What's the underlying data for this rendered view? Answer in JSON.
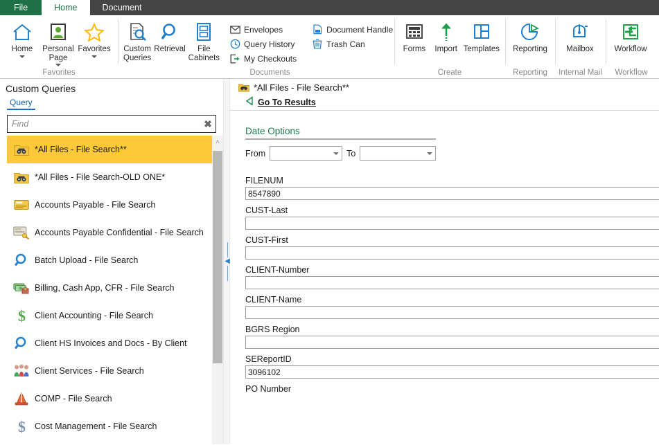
{
  "window": {
    "title": "Custom Queries"
  },
  "ribbon": {
    "tabs": [
      {
        "label": "File",
        "kind": "file",
        "active": false
      },
      {
        "label": "Home",
        "kind": "normal",
        "active": true
      },
      {
        "label": "Document",
        "kind": "normal",
        "active": false
      }
    ],
    "groups": [
      {
        "label": "Favorites",
        "buttons": [
          {
            "label": "Home",
            "icon": "home-icon",
            "dropdown": true
          },
          {
            "label": "Personal Page",
            "icon": "person-card-icon",
            "dropdown": true
          },
          {
            "label": "Favorites",
            "icon": "star-icon",
            "dropdown": true
          }
        ]
      },
      {
        "label": "Documents",
        "buttons": [
          {
            "label": "Custom Queries",
            "icon": "document-search-icon",
            "dropdown": false
          },
          {
            "label": "Retrieval",
            "icon": "magnifier-icon",
            "dropdown": false
          },
          {
            "label": "File Cabinets",
            "icon": "file-cabinet-icon",
            "dropdown": false
          }
        ],
        "small_buttons": [
          {
            "label": "Envelopes",
            "icon": "envelope-icon"
          },
          {
            "label": "Query History",
            "icon": "clock-icon"
          },
          {
            "label": "My Checkouts",
            "icon": "checkout-icon"
          },
          {
            "label": "Document Handle",
            "icon": "document-handle-icon"
          },
          {
            "label": "Trash Can",
            "icon": "trash-icon"
          }
        ]
      },
      {
        "label": "Create",
        "buttons": [
          {
            "label": "Forms",
            "icon": "forms-icon",
            "dropdown": false
          },
          {
            "label": "Import",
            "icon": "import-arrow-icon",
            "dropdown": false
          },
          {
            "label": "Templates",
            "icon": "templates-icon",
            "dropdown": false
          }
        ]
      },
      {
        "label": "Reporting",
        "buttons": [
          {
            "label": "Reporting",
            "icon": "pie-chart-icon",
            "dropdown": false
          }
        ]
      },
      {
        "label": "Internal Mail",
        "buttons": [
          {
            "label": "Mailbox",
            "icon": "mailbox-icon",
            "dropdown": false
          }
        ]
      },
      {
        "label": "Workflow",
        "buttons": [
          {
            "label": "Workflow",
            "icon": "workflow-arrow-icon",
            "dropdown": false
          }
        ]
      }
    ]
  },
  "left_panel": {
    "title": "Custom Queries",
    "subtab": "Query",
    "find": {
      "value": "",
      "placeholder": "Find",
      "clear_label": "✖"
    },
    "items": [
      {
        "label": "*All Files - File Search**",
        "icon": "binoculars-folder-icon",
        "selected": true
      },
      {
        "label": "*All Files - File Search-OLD ONE*",
        "icon": "binoculars-folder-icon",
        "selected": false
      },
      {
        "label": "Accounts Payable - File Search",
        "icon": "card-icon",
        "selected": false
      },
      {
        "label": "Accounts Payable Confidential - File Search",
        "icon": "card-key-icon",
        "selected": false
      },
      {
        "label": "Batch Upload - File Search",
        "icon": "magnifier-icon",
        "selected": false
      },
      {
        "label": "Billing, Cash App, CFR - File Search",
        "icon": "money-icon",
        "selected": false
      },
      {
        "label": "Client Accounting - File Search",
        "icon": "dollar-green-icon",
        "selected": false
      },
      {
        "label": "Client HS Invoices and Docs - By Client",
        "icon": "magnifier-icon",
        "selected": false
      },
      {
        "label": "Client Services - File Search",
        "icon": "people-icon",
        "selected": false
      },
      {
        "label": "COMP - File Search",
        "icon": "cone-icon",
        "selected": false
      },
      {
        "label": "Cost Management - File Search",
        "icon": "dollar-blue-icon",
        "selected": false
      }
    ],
    "scrollbar": {
      "up_arrow": "˄"
    }
  },
  "splitter": {
    "collapse_icon": "chevron-left-icon"
  },
  "right_panel": {
    "doc_title": "*All Files - File Search**",
    "doc_icon": "binoculars-folder-icon",
    "go_to_results": {
      "label": "Go To Results",
      "icon": "triangle-left-icon"
    },
    "date_options": {
      "title": "Date Options",
      "from_label": "From",
      "from_value": "",
      "to_label": "To",
      "to_value": ""
    },
    "fields": [
      {
        "label": "FILENUM",
        "value": "8547890"
      },
      {
        "label": "CUST-Last",
        "value": ""
      },
      {
        "label": "CUST-First",
        "value": ""
      },
      {
        "label": "CLIENT-Number",
        "value": ""
      },
      {
        "label": "CLIENT-Name",
        "value": ""
      },
      {
        "label": "BGRS Region",
        "value": ""
      },
      {
        "label": "SEReportID",
        "value": "3096102"
      },
      {
        "label": "PO Number",
        "value": ""
      }
    ]
  },
  "colors": {
    "file_tab_green": "#1e7145",
    "tabstrip_dark": "#444444",
    "selection_yellow": "#fdc939",
    "section_green": "#1a7a4e",
    "accent_blue": "#1f6fc4"
  }
}
